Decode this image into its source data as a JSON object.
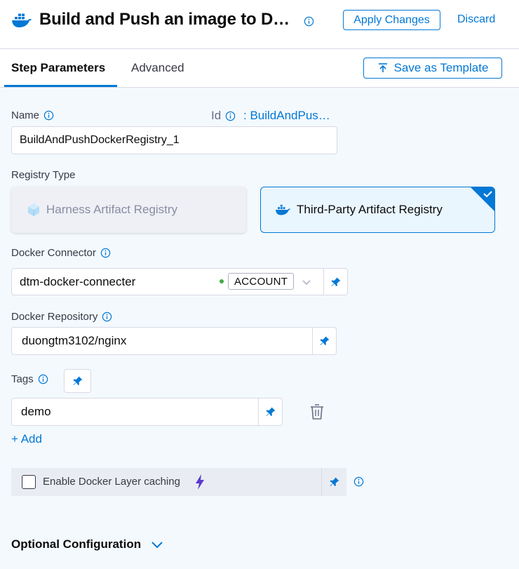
{
  "header": {
    "title": "Build and Push an image to D…",
    "apply_label": "Apply Changes",
    "discard_label": "Discard"
  },
  "tabs": [
    {
      "label": "Step Parameters",
      "active": true
    },
    {
      "label": "Advanced",
      "active": false
    }
  ],
  "save_template_label": "Save as Template",
  "name_field": {
    "label": "Name",
    "value": "BuildAndPushDockerRegistry_1",
    "id_label": "Id",
    "id_value": ": BuildAndPus…"
  },
  "registry_type": {
    "label": "Registry Type",
    "options": [
      {
        "label": "Harness Artifact Registry",
        "selected": false
      },
      {
        "label": "Third-Party Artifact Registry",
        "selected": true
      }
    ]
  },
  "docker_connector": {
    "label": "Docker Connector",
    "value": "dtm-docker-connecter",
    "scope_badge": "ACCOUNT",
    "status_color": "#42ab45"
  },
  "docker_repository": {
    "label": "Docker Repository",
    "value": "duongtm3102/nginx"
  },
  "tags": {
    "label": "Tags",
    "items": [
      "demo"
    ],
    "add_label": "+ Add"
  },
  "layer_caching": {
    "label": "Enable Docker Layer caching",
    "checked": false
  },
  "optional_config_label": "Optional Configuration",
  "colors": {
    "primary": "#0278d5",
    "background": "#f3f9fd",
    "lightning": "#5b3ad1"
  }
}
